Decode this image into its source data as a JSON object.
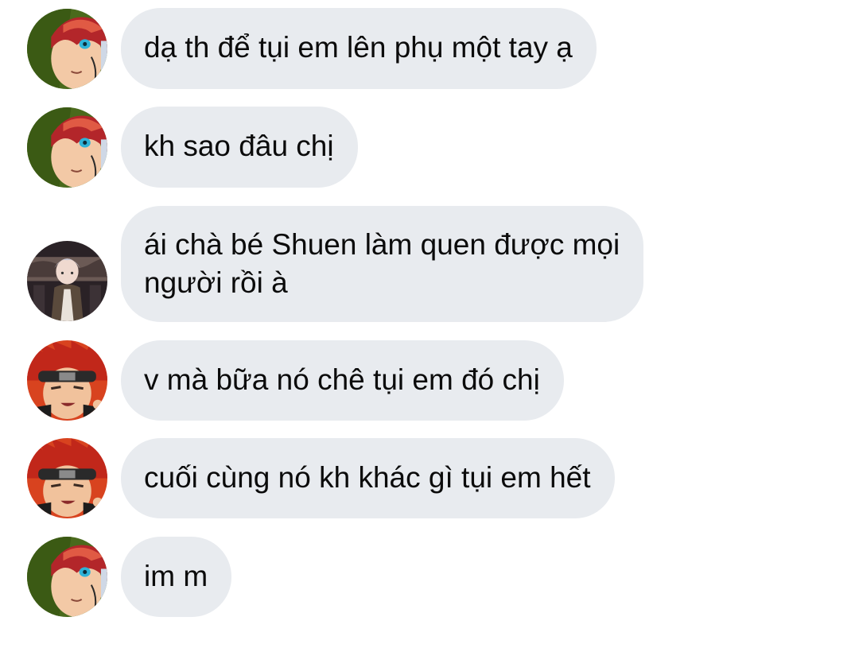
{
  "messages": [
    {
      "avatar": "red-green-hair-boy-avatar-icon",
      "text": "dạ th để tụi em lên phụ một tay ạ"
    },
    {
      "avatar": "red-green-hair-boy-avatar-icon",
      "text": "kh sao đâu chị"
    },
    {
      "avatar": "silver-hair-man-avatar-icon",
      "lines": [
        "ái chà bé Shuen làm quen được mọi",
        "người rồi à"
      ]
    },
    {
      "avatar": "red-spiky-hair-headband-boy-avatar-icon",
      "text": "v mà bữa nó chê tụi em đó chị"
    },
    {
      "avatar": "red-spiky-hair-headband-boy-avatar-icon",
      "text": "cuối cùng nó kh khác gì tụi em hết"
    },
    {
      "avatar": "red-green-hair-boy-avatar-icon",
      "text": "im m"
    }
  ],
  "colors": {
    "bubble_bg": "#e8ebef",
    "text": "#0b0b0b",
    "page_bg": "#ffffff"
  }
}
